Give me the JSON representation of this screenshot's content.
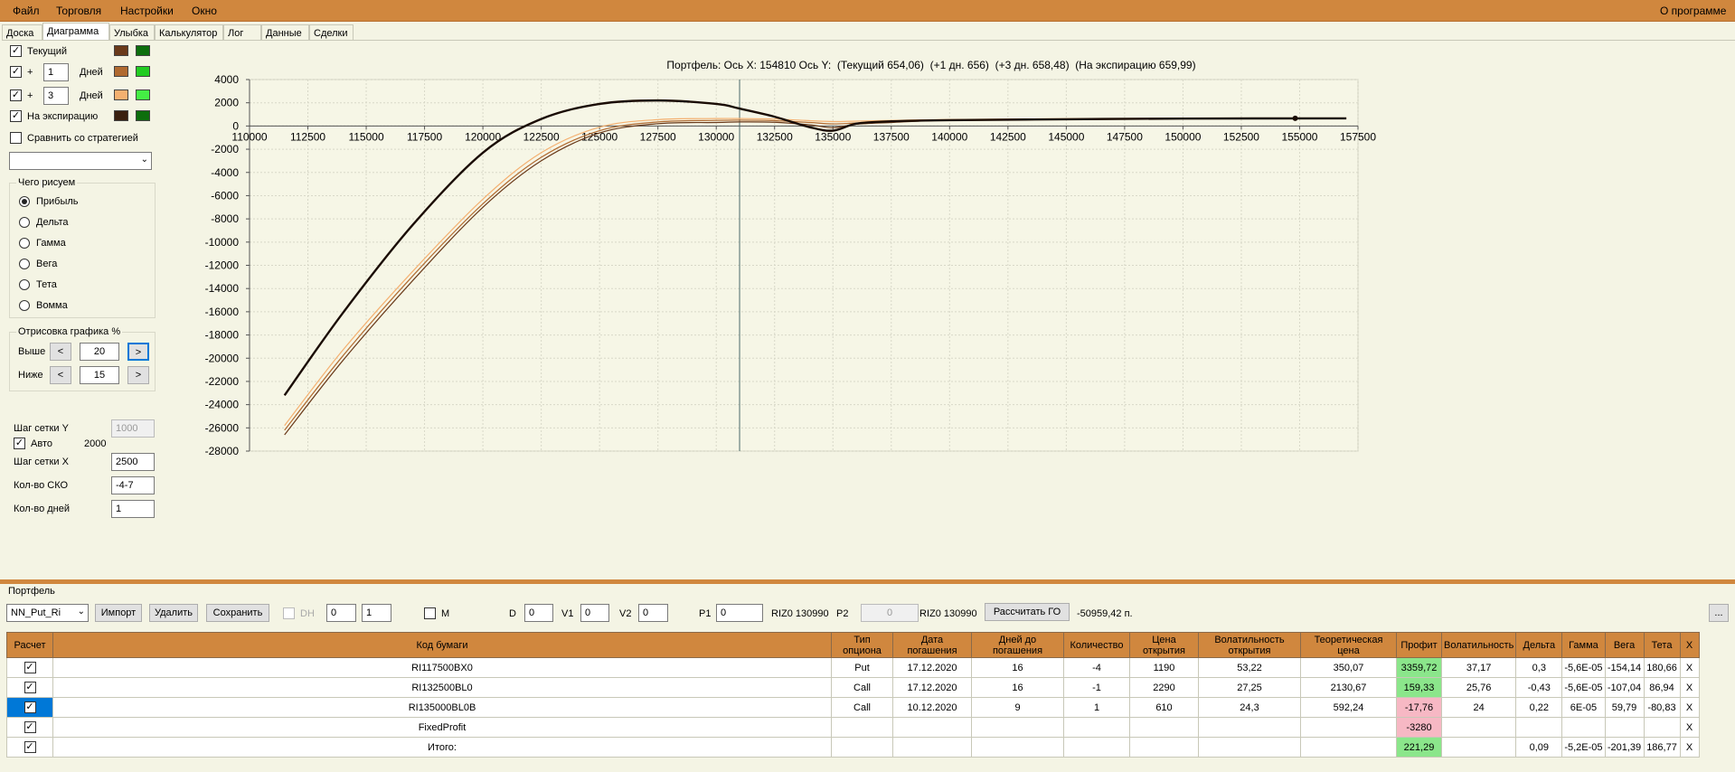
{
  "menu": {
    "items": [
      "Файл",
      "Торговля",
      "Настройки",
      "Окно"
    ],
    "about": "О программе"
  },
  "tabs": [
    "Доска",
    "Диаграмма",
    "Улыбка",
    "Калькулятор",
    "Лог",
    "Данные",
    "Сделки"
  ],
  "left": {
    "series": [
      {
        "label": "Текущий",
        "checked": true
      },
      {
        "plus": "+",
        "days": "1",
        "unit": "Дней",
        "checked": true
      },
      {
        "plus": "+",
        "days": "3",
        "unit": "Дней",
        "checked": true
      },
      {
        "label": "На экспирацию",
        "checked": true
      }
    ],
    "colors": [
      [
        "#6a3a1a",
        "#0d6e0d"
      ],
      [
        "#b06a30",
        "#22cc22"
      ],
      [
        "#f4b070",
        "#44ee44"
      ],
      [
        "#3a2010",
        "#0d6e0d"
      ]
    ],
    "compare": "Сравнить со стратегией",
    "what_title": "Чего рисуем",
    "what_options": [
      "Прибыль",
      "Дельта",
      "Гамма",
      "Вега",
      "Тета",
      "Вомма"
    ],
    "draw_title": "Отрисовка графика %",
    "above_label": "Выше",
    "above_value": "20",
    "below_label": "Ниже",
    "below_value": "15",
    "btn_prev": "<",
    "btn_next": ">",
    "grid_y_label": "Шаг сетки Y",
    "grid_y_value": "1000",
    "auto_label": "Авто",
    "auto_value": "2000",
    "grid_x_label": "Шаг сетки X",
    "grid_x_value": "2500",
    "sko_label": "Кол-во СКО",
    "sko_value": "-4-7",
    "days_label": "Кол-во дней",
    "days_value": "1"
  },
  "chart_title": "Портфель: Ось X: 154810 Ось Y:  (Текущий 654,06)  (+1 дн. 656)  (+3 дн. 658,48)  (На экспирацию 659,99)",
  "chart_data": {
    "type": "line",
    "xlim": [
      110000,
      157500
    ],
    "ylim": [
      -28000,
      4000
    ],
    "x_ticks": [
      110000,
      112500,
      115000,
      117500,
      120000,
      122500,
      125000,
      127500,
      130000,
      132500,
      135000,
      137500,
      140000,
      142500,
      145000,
      147500,
      150000,
      152500,
      155000,
      157500
    ],
    "y_ticks": [
      4000,
      2000,
      0,
      -2000,
      -4000,
      -6000,
      -8000,
      -10000,
      -12000,
      -14000,
      -16000,
      -18000,
      -20000,
      -22000,
      -24000,
      -26000,
      -28000
    ],
    "cursor_x": 131000,
    "marker": {
      "x": 154810,
      "y": 660
    },
    "x": [
      111500,
      114000,
      117000,
      120000,
      122500,
      125000,
      127500,
      130000,
      131000,
      132500,
      134000,
      135000,
      136000,
      137500,
      140000,
      145000,
      150000,
      157000
    ],
    "series": [
      {
        "name": "Текущий",
        "color": "#6a3a1a",
        "values": [
          -26600,
          -20200,
          -13300,
          -7000,
          -3000,
          -600,
          200,
          300,
          350,
          320,
          100,
          -150,
          150,
          300,
          500,
          600,
          640,
          660
        ]
      },
      {
        "name": "+1 дн.",
        "color": "#b06a30",
        "values": [
          -26200,
          -19800,
          -12900,
          -6700,
          -2700,
          -400,
          350,
          480,
          500,
          460,
          300,
          180,
          260,
          380,
          520,
          610,
          650,
          665
        ]
      },
      {
        "name": "+3 дн.",
        "color": "#f4b070",
        "values": [
          -25800,
          -19300,
          -12500,
          -6300,
          -2300,
          -100,
          550,
          640,
          640,
          600,
          460,
          380,
          420,
          480,
          560,
          620,
          650,
          665
        ]
      },
      {
        "name": "На экспирацию",
        "color": "#1a0c04",
        "values": [
          -23200,
          -16100,
          -8500,
          -2300,
          600,
          1900,
          2200,
          1900,
          1500,
          800,
          -100,
          -400,
          200,
          400,
          500,
          580,
          640,
          660
        ]
      }
    ]
  },
  "portfolio": {
    "title": "Портфель",
    "select": "NN_Put_Ri",
    "import": "Импорт",
    "delete": "Удалить",
    "save": "Сохранить",
    "dh": "DH",
    "dh_a": "0",
    "dh_b": "1",
    "m": "M",
    "d_label": "D",
    "d_value": "0",
    "v1_label": "V1",
    "v1_value": "0",
    "v2_label": "V2",
    "v2_value": "0",
    "p1_label": "P1",
    "p1_value": "0",
    "p1_code": "RIZ0 130990",
    "p2_label": "P2",
    "p2_value": "0",
    "p2_code": "RIZ0 130990",
    "calc_go": "Рассчитать ГО",
    "go_value": "-50959,42 п.",
    "more": "..."
  },
  "table": {
    "headers": [
      "Расчет",
      "Код бумаги",
      "Тип опциона",
      "Дата погашения",
      "Дней до погашения",
      "Количество",
      "Цена открытия",
      "Волатильность открытия",
      "Теоретическая цена",
      "Профит",
      "Волатильность",
      "Дельта",
      "Гамма",
      "Вега",
      "Тета",
      "X"
    ],
    "rows": [
      [
        "✓",
        "RI117500BX0",
        "Put",
        "17.12.2020",
        "16",
        "-4",
        "1190",
        "53,22",
        "350,07",
        "3359,72",
        "37,17",
        "0,3",
        "-5,6E-05",
        "-154,14",
        "180,66",
        "X"
      ],
      [
        "✓",
        "RI132500BL0",
        "Call",
        "17.12.2020",
        "16",
        "-1",
        "2290",
        "27,25",
        "2130,67",
        "159,33",
        "25,76",
        "-0,43",
        "-5,6E-05",
        "-107,04",
        "86,94",
        "X"
      ],
      [
        "✓",
        "RI135000BL0B",
        "Call",
        "10.12.2020",
        "9",
        "1",
        "610",
        "24,3",
        "592,24",
        "-17,76",
        "24",
        "0,22",
        "6E-05",
        "59,79",
        "-80,83",
        "X"
      ],
      [
        "✓",
        "FixedProfit",
        "",
        "",
        "",
        "",
        "",
        "",
        "",
        "-3280",
        "",
        "",
        "",
        "",
        "",
        "X"
      ],
      [
        "✓",
        "Итого:",
        "",
        "",
        "",
        "",
        "",
        "",
        "",
        "221,29",
        "",
        "0,09",
        "-5,2E-05",
        "-201,39",
        "186,77",
        "X"
      ]
    ]
  }
}
